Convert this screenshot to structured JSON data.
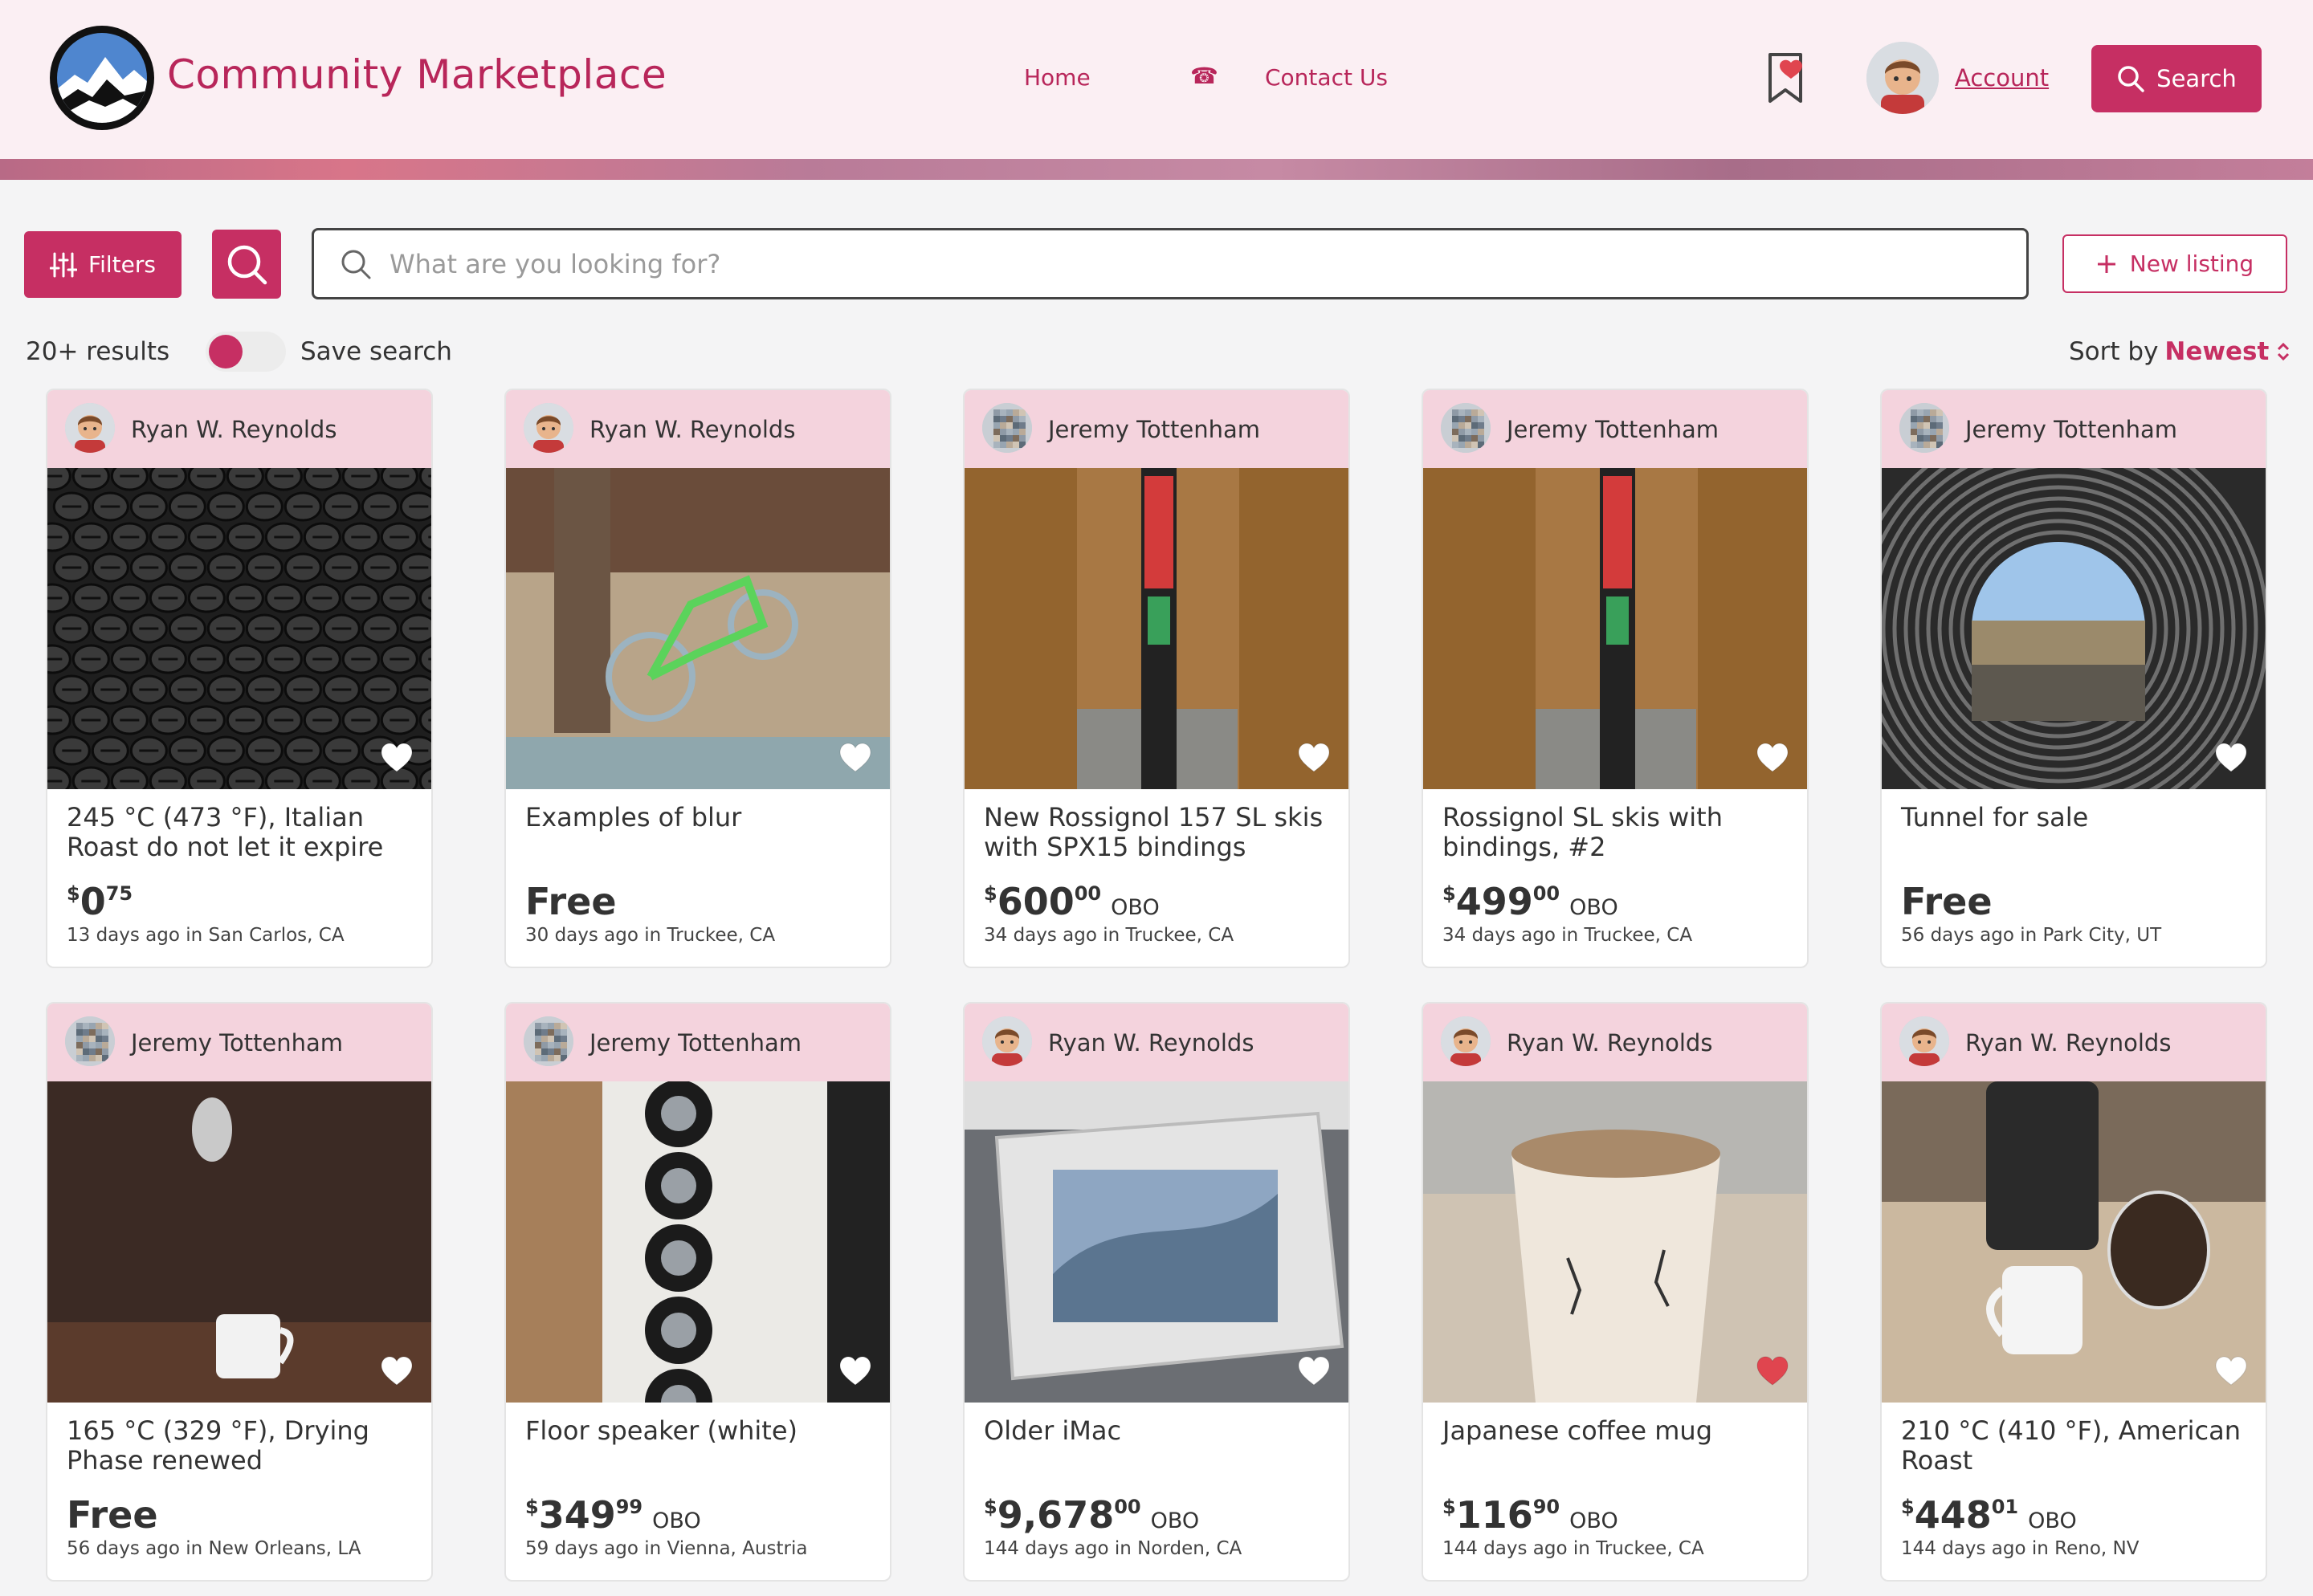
{
  "header": {
    "brand": "Community Marketplace",
    "nav": {
      "home": "Home",
      "contact": "Contact Us",
      "phone_glyph": "☎"
    },
    "account": "Account",
    "search_button": "Search"
  },
  "toolbar": {
    "filters": "Filters",
    "search_placeholder": "What are you looking for?",
    "new_listing": "New listing",
    "results": "20+ results",
    "save_search": "Save search",
    "sort_label": "Sort by",
    "sort_value": "Newest"
  },
  "colors": {
    "accent": "#c62f63",
    "header_bg": "#fbeff3",
    "card_head": "#f4d3dd",
    "heart_liked": "#e0454f"
  },
  "listings": [
    {
      "seller": "Ryan W. Reynolds",
      "title": "245 °C (473 °F), Italian Roast do not let it expire",
      "price_cur": "$",
      "price_main": "0",
      "price_cents": "75",
      "obo": "",
      "free": "",
      "meta": "13 days ago in San Carlos, CA",
      "liked": false
    },
    {
      "seller": "Ryan W. Reynolds",
      "title": "Examples of blur",
      "price_cur": "",
      "price_main": "",
      "price_cents": "",
      "obo": "",
      "free": "Free",
      "meta": "30 days ago in Truckee, CA",
      "liked": false
    },
    {
      "seller": "Jeremy Tottenham",
      "title": "New Rossignol 157 SL skis with SPX15 bindings",
      "price_cur": "$",
      "price_main": "600",
      "price_cents": "00",
      "obo": "OBO",
      "free": "",
      "meta": "34 days ago in Truckee, CA",
      "liked": false
    },
    {
      "seller": "Jeremy Tottenham",
      "title": "Rossignol SL skis with bindings, #2",
      "price_cur": "$",
      "price_main": "499",
      "price_cents": "00",
      "obo": "OBO",
      "free": "",
      "meta": "34 days ago in Truckee, CA",
      "liked": false
    },
    {
      "seller": "Jeremy Tottenham",
      "title": "Tunnel for sale",
      "price_cur": "",
      "price_main": "",
      "price_cents": "",
      "obo": "",
      "free": "Free",
      "meta": "56 days ago in Park City, UT",
      "liked": false
    },
    {
      "seller": "Jeremy Tottenham",
      "title": "165 °C (329 °F), Drying Phase renewed",
      "price_cur": "",
      "price_main": "",
      "price_cents": "",
      "obo": "",
      "free": "Free",
      "meta": "56 days ago in New Orleans, LA",
      "liked": false
    },
    {
      "seller": "Jeremy Tottenham",
      "title": "Floor speaker (white)",
      "price_cur": "$",
      "price_main": "349",
      "price_cents": "99",
      "obo": "OBO",
      "free": "",
      "meta": "59 days ago in Vienna, Austria",
      "liked": false
    },
    {
      "seller": "Ryan W. Reynolds",
      "title": "Older iMac",
      "price_cur": "$",
      "price_main": "9,678",
      "price_cents": "00",
      "obo": "OBO",
      "free": "",
      "meta": "144 days ago in Norden, CA",
      "liked": false
    },
    {
      "seller": "Ryan W. Reynolds",
      "title": "Japanese coffee mug",
      "price_cur": "$",
      "price_main": "116",
      "price_cents": "90",
      "obo": "OBO",
      "free": "",
      "meta": "144 days ago in Truckee, CA",
      "liked": true
    },
    {
      "seller": "Ryan W. Reynolds",
      "title": "210 °C (410 °F), American Roast",
      "price_cur": "$",
      "price_main": "448",
      "price_cents": "01",
      "obo": "OBO",
      "free": "",
      "meta": "144 days ago in Reno, NV",
      "liked": false
    }
  ]
}
